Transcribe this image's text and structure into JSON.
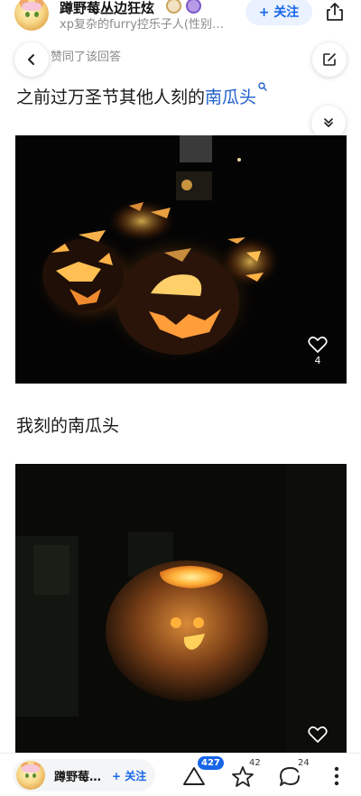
{
  "author": {
    "name": "蹲野莓丛边狂炫",
    "bio": "xp复杂的furry控乐子人(性别…",
    "follow_label": "+ 关注"
  },
  "activity": {
    "liked_text": "赞同了该回答"
  },
  "content": {
    "paragraph1_prefix": "之前过万圣节其他人刻的",
    "paragraph1_link": "南瓜头",
    "photo1_like_count": "4",
    "paragraph2": "我刻的南瓜头"
  },
  "bottom_bar": {
    "author_short": "蹲野莓…",
    "follow_label": "+ 关注",
    "upvote_count": "427",
    "favorite_count": "42",
    "comment_count": "24"
  },
  "icons": [
    "share-icon",
    "back-icon",
    "edit-icon",
    "collapse-icon",
    "heart-icon",
    "upvote-icon",
    "star-icon",
    "comment-icon",
    "more-icon",
    "search-link-icon"
  ],
  "colors": {
    "accent": "#1766e8",
    "link": "#1f5fcc",
    "muted": "#8a8a8a"
  }
}
